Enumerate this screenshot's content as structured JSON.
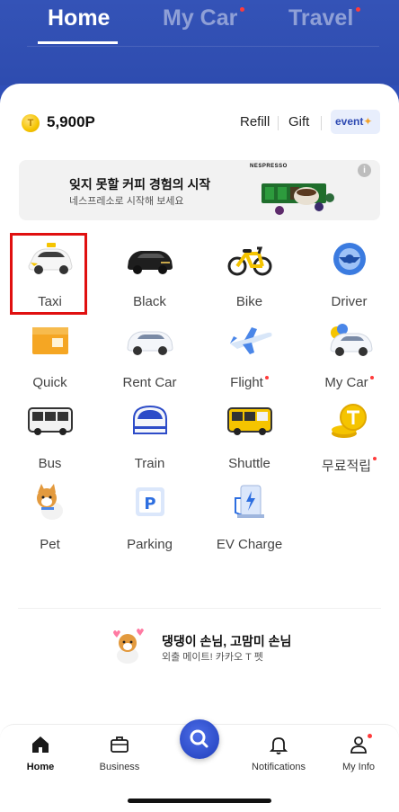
{
  "top_tabs": {
    "home": "Home",
    "my_car": "My Car",
    "travel": "Travel"
  },
  "points": {
    "coin_symbol": "T",
    "value": "5,900P",
    "refill": "Refill",
    "gift": "Gift",
    "event": "event"
  },
  "banner": {
    "title": "잊지 못할 커피 경험의 시작",
    "subtitle": "네스프레소로 시작해 보세요",
    "brand": "NESPRESSO",
    "info": "i"
  },
  "services": [
    {
      "label": "Taxi",
      "icon": "taxi-icon"
    },
    {
      "label": "Black",
      "icon": "black-car-icon"
    },
    {
      "label": "Bike",
      "icon": "bike-icon"
    },
    {
      "label": "Driver",
      "icon": "steering-wheel-icon"
    },
    {
      "label": "Quick",
      "icon": "box-icon"
    },
    {
      "label": "Rent Car",
      "icon": "rent-car-icon"
    },
    {
      "label": "Flight",
      "icon": "airplane-icon"
    },
    {
      "label": "My Car",
      "icon": "my-car-icon"
    },
    {
      "label": "Bus",
      "icon": "bus-icon"
    },
    {
      "label": "Train",
      "icon": "train-icon"
    },
    {
      "label": "Shuttle",
      "icon": "shuttle-icon"
    },
    {
      "label": "무료적립",
      "icon": "coin-stack-icon"
    },
    {
      "label": "Pet",
      "icon": "dog-icon"
    },
    {
      "label": "Parking",
      "icon": "parking-icon"
    },
    {
      "label": "EV Charge",
      "icon": "ev-charger-icon"
    }
  ],
  "promo": {
    "title": "댕댕이 손님, 고맘미 손님",
    "subtitle": "외출 메이트! 카카오 T 펫"
  },
  "bottom_nav": {
    "home": "Home",
    "business": "Business",
    "notifications": "Notifications",
    "my_info": "My Info"
  },
  "colors": {
    "brand_blue": "#2e4caf",
    "notification_dot": "#ff3b3b",
    "selection_outline": "#e01010"
  }
}
